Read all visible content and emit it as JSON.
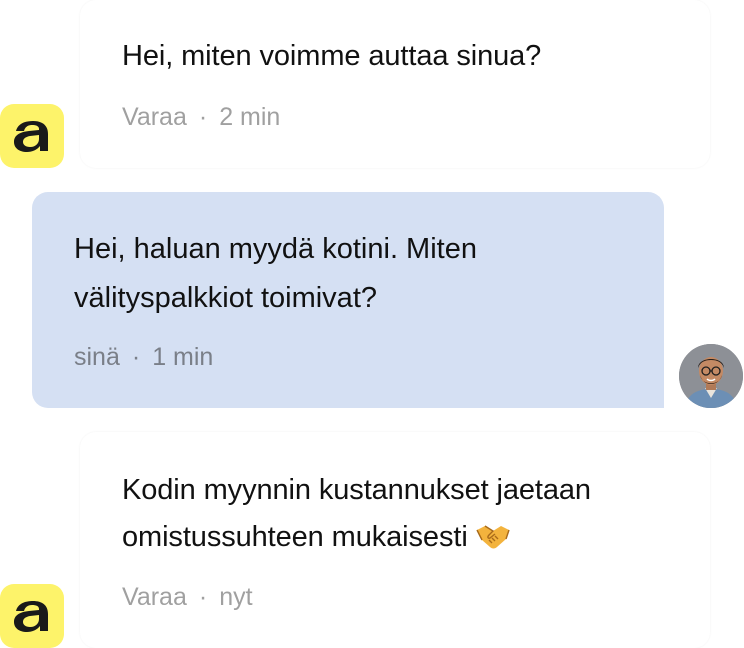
{
  "conversation": {
    "messages": [
      {
        "sender": "agent",
        "text": "Hei, miten voimme auttaa sinua?",
        "author": "Varaa",
        "time": "2 min"
      },
      {
        "sender": "user",
        "text": "Hei, haluan myydä kotini. Miten\nvälityspalkkiot toimivat?",
        "author": "sinä",
        "time": "1 min"
      },
      {
        "sender": "agent",
        "text": "Kodin myynnin kustannukset jaetaan\nomistussuhteen mukaisesti",
        "emoji": "🤝",
        "author": "Varaa",
        "time": "nyt"
      }
    ],
    "separator": "·",
    "agent_logo_letter": "a"
  },
  "colors": {
    "agent_logo_bg": "#fdf36a",
    "user_bubble_bg": "#d5e0f3",
    "text": "#111111",
    "meta_agent": "#a0a0a0",
    "meta_user": "#7a7f88"
  },
  "icons": {
    "agent_avatar": "varaa-logo-icon",
    "user_avatar": "user-photo-avatar",
    "handshake": "handshake-emoji-icon"
  }
}
